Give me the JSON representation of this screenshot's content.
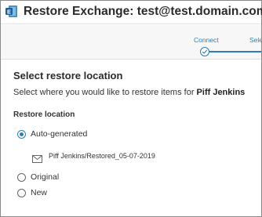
{
  "window": {
    "title": "Restore Exchange: test@test.domain.com",
    "app_icon": "exchange-logo-icon",
    "accent_color": "#2a7fb8"
  },
  "stepper": {
    "steps": [
      {
        "label": "Connect",
        "state": "completed"
      },
      {
        "label": "Sele",
        "state": "current"
      }
    ]
  },
  "main": {
    "heading": "Select restore location",
    "subtitle_prefix": "Select where you would like to restore items for ",
    "user_name": "Piff Jenkins",
    "section_label": "Restore location",
    "options": [
      {
        "label": "Auto-generated",
        "selected": true
      },
      {
        "label": "Original",
        "selected": false
      },
      {
        "label": "New",
        "selected": false
      }
    ],
    "auto_path_icon": "envelope-icon",
    "auto_path": "Piff Jenkins/Restored_05-07-2019"
  }
}
